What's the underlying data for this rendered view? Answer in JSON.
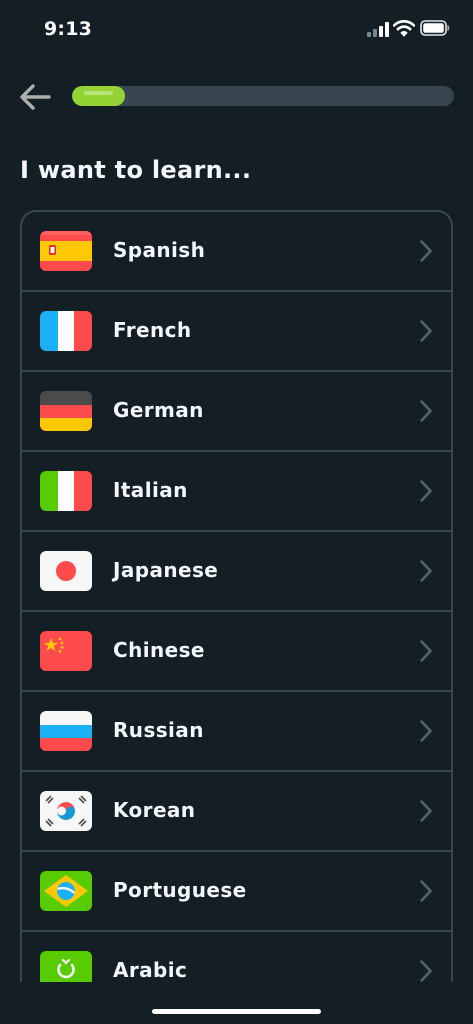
{
  "status_bar": {
    "time": "9:13"
  },
  "header": {
    "progress_fraction": 0.14
  },
  "page": {
    "title": "I want to learn..."
  },
  "languages": [
    {
      "label": "Spanish",
      "flag": "spain-flag-icon"
    },
    {
      "label": "French",
      "flag": "france-flag-icon"
    },
    {
      "label": "German",
      "flag": "germany-flag-icon"
    },
    {
      "label": "Italian",
      "flag": "italy-flag-icon"
    },
    {
      "label": "Japanese",
      "flag": "japan-flag-icon"
    },
    {
      "label": "Chinese",
      "flag": "china-flag-icon"
    },
    {
      "label": "Russian",
      "flag": "russia-flag-icon"
    },
    {
      "label": "Korean",
      "flag": "korea-flag-icon"
    },
    {
      "label": "Portuguese",
      "flag": "brazil-flag-icon"
    },
    {
      "label": "Arabic",
      "flag": "arabic-flag-icon"
    }
  ],
  "colors": {
    "background": "#131f24",
    "border": "#37464f",
    "accent_green": "#93d333",
    "text": "#f1f7fb",
    "chevron": "#52656d"
  }
}
